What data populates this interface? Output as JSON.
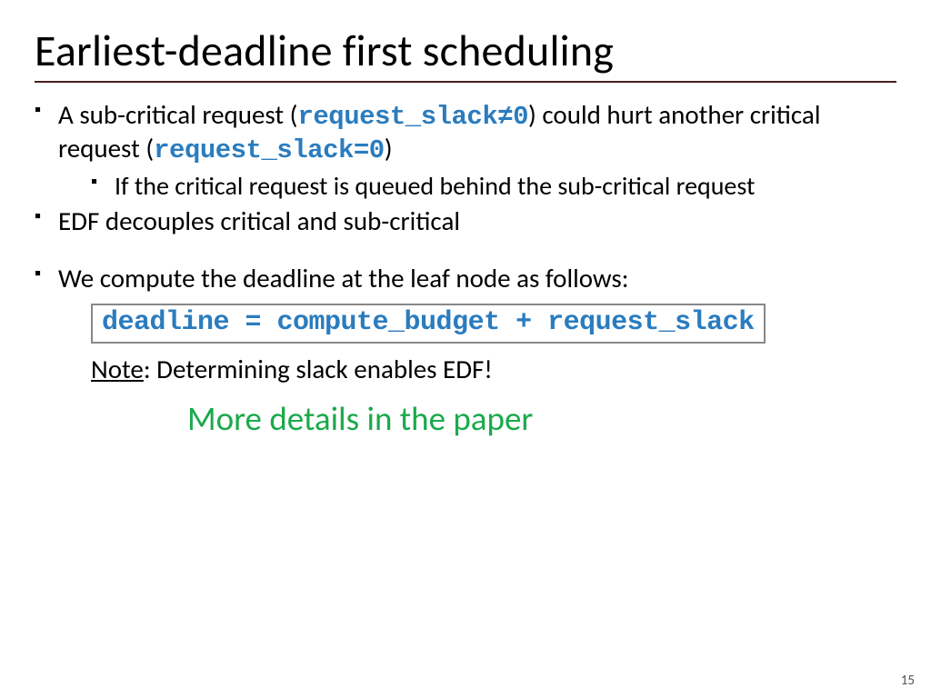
{
  "title": "Earliest-deadline first scheduling",
  "bullets": {
    "b1_pre": "A sub-critical request (",
    "b1_code1": "request_slack",
    "b1_neq": "≠0",
    "b1_mid": ") could hurt another critical request (",
    "b1_code2": "request_slack",
    "b1_eq": "=0",
    "b1_post": ")",
    "b1_sub1": "If the critical request is queued behind the sub-critical request",
    "b2": "EDF decouples critical and sub-critical",
    "b3": "We compute the deadline at the leaf node as follows:"
  },
  "formula": "deadline = compute_budget + request_slack",
  "note_label": "Note",
  "note_rest": ": Determining slack enables EDF!",
  "more": "More details in the paper",
  "page": "15"
}
